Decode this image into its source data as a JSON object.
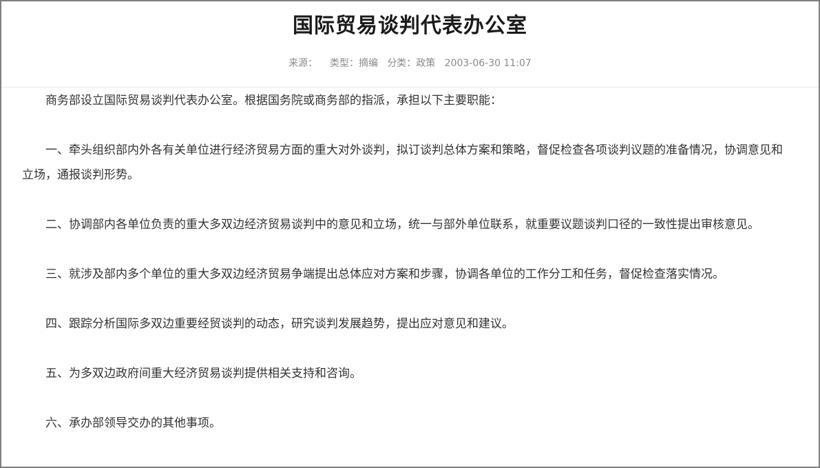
{
  "article": {
    "title": "国际贸易谈判代表办公室",
    "meta": {
      "source_label": "来源：",
      "type_label": "类型：",
      "type_value": "摘编",
      "category_label": "分类：",
      "category_value": "政策",
      "datetime": "2003-06-30 11:07"
    },
    "paragraphs": [
      "商务部设立国际贸易谈判代表办公室。根据国务院或商务部的指派，承担以下主要职能：",
      "一、牵头组织部内外各有关单位进行经济贸易方面的重大对外谈判，拟订谈判总体方案和策略，督促检查各项谈判议题的准备情况，协调意见和立场，通报谈判形势。",
      "二、协调部内各单位负责的重大多双边经济贸易谈判中的意见和立场，统一与部外单位联系，就重要议题谈判口径的一致性提出审核意见。",
      "三、就涉及部内多个单位的重大多双边经济贸易争端提出总体应对方案和步骤，协调各单位的工作分工和任务，督促检查落实情况。",
      "四、跟踪分析国际多双边重要经贸谈判的动态，研究谈判发展趋势，提出应对意见和建议。",
      "五、为多双边政府间重大经济贸易谈判提供相关支持和咨询。",
      "六、承办部领导交办的其他事项。"
    ]
  }
}
